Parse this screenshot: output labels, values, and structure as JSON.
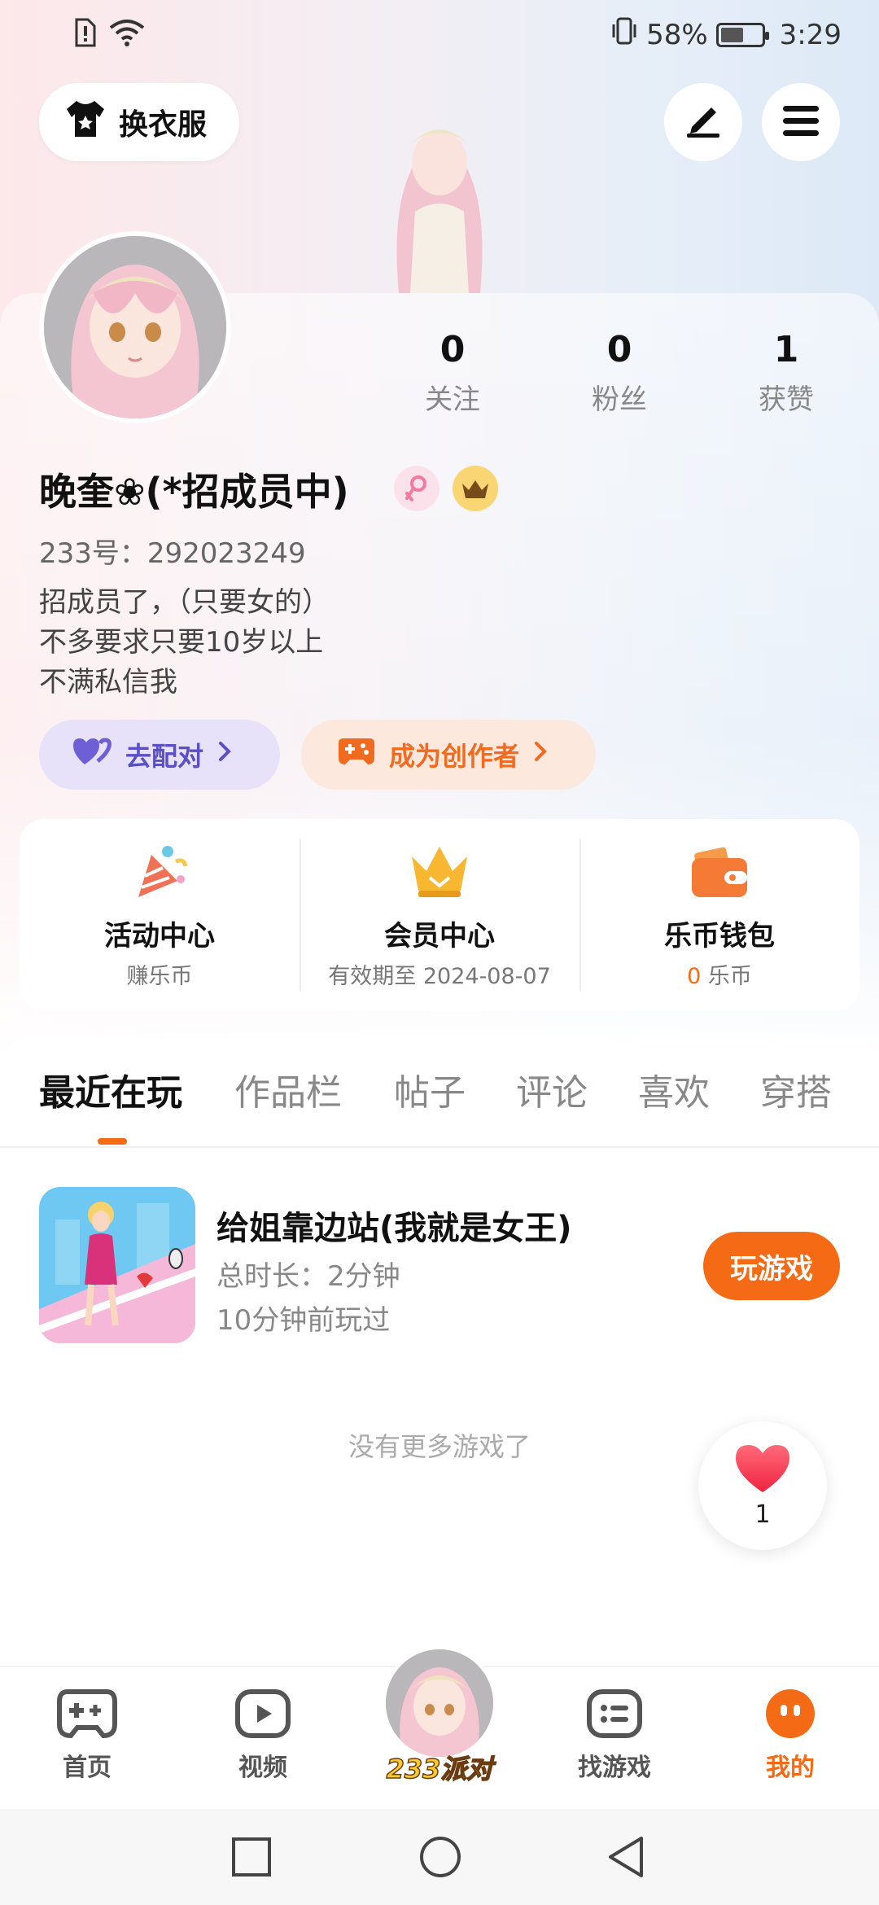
{
  "status_bar": {
    "battery": "58%",
    "battery_level": 0.58,
    "time": "3:29"
  },
  "header": {
    "outfit_label": "换衣服"
  },
  "stats": [
    {
      "value": "0",
      "label": "关注"
    },
    {
      "value": "0",
      "label": "粉丝"
    },
    {
      "value": "1",
      "label": "获赞"
    }
  ],
  "profile": {
    "name": "晚奎❀(*招成员中)",
    "uid": "233号：292023249",
    "bio": [
      "招成员了，（只要女的）",
      "不多要求只要10岁以上",
      "不满私信我"
    ]
  },
  "actions": {
    "match_label": "去配对",
    "creator_label": "成为创作者"
  },
  "services": [
    {
      "title": "活动中心",
      "sub": "赚乐币"
    },
    {
      "title": "会员中心",
      "sub": "有效期至 2024-08-07"
    },
    {
      "title": "乐币钱包",
      "sub_value": "0",
      "sub_unit": "乐币"
    }
  ],
  "tabs": [
    "最近在玩",
    "作品栏",
    "帖子",
    "评论",
    "喜欢",
    "穿搭"
  ],
  "recent_game": {
    "title": "给姐靠边站(我就是女王)",
    "duration": "总时长：2分钟",
    "last_played": "10分钟前玩过",
    "play_label": "玩游戏"
  },
  "no_more": "没有更多游戏了",
  "like_count": "1",
  "bottom_nav": {
    "home": "首页",
    "video": "视频",
    "center": "233派对",
    "find": "找游戏",
    "mine": "我的"
  },
  "colors": {
    "accent": "#f56a14",
    "match": "#5b4fc4"
  }
}
